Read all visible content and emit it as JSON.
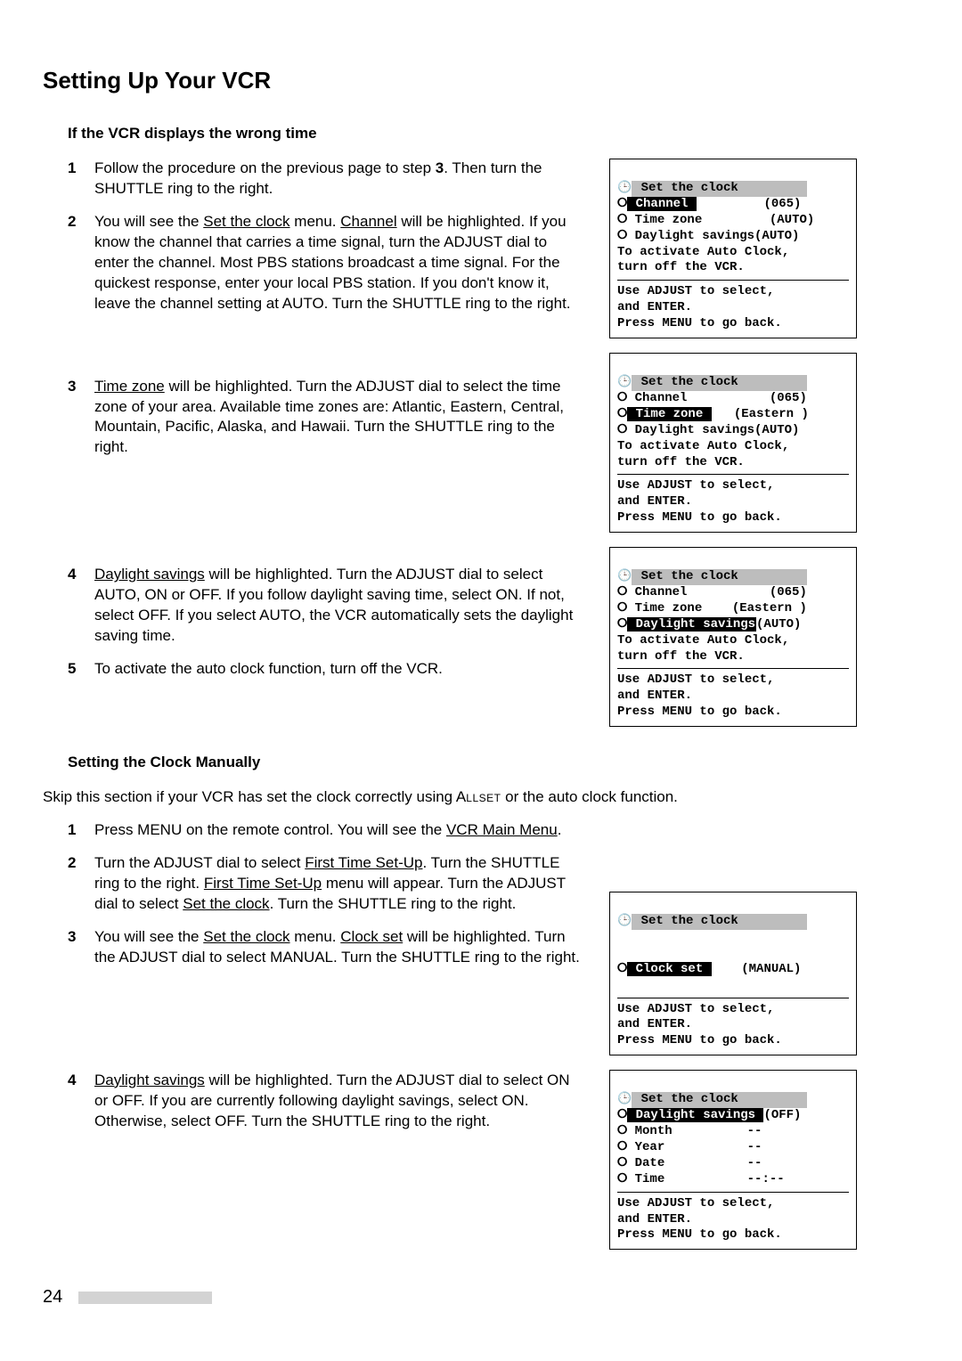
{
  "title": "Setting Up Your VCR",
  "sec1": {
    "heading": "If the VCR displays the wrong time",
    "s1a": "Follow the procedure on the previous page to step ",
    "s1b": "3",
    "s1c": ".  Then turn the SHUTTLE ring to the right.",
    "s2a": "You will see the ",
    "s2b": "Set the clock",
    "s2c": " menu.  ",
    "s2d": "Channel",
    "s2e": " will be highlighted.  If you know the channel that carries a time signal, turn the ADJUST dial to enter the channel.  Most PBS stations broadcast a time signal.  For the quickest response, enter your local PBS station.  If you don't know it, leave the channel setting at AUTO.  Turn the SHUTTLE ring to the right.",
    "s3a": "Time zone",
    "s3b": " will be highlighted.  Turn the ADJUST dial to select the time zone of your area.  Available time zones are:  Atlantic, Eastern, Central, Mountain, Pacific, Alaska, and Hawaii.  Turn the SHUTTLE ring to the right.",
    "s4a": "Daylight savings",
    "s4b": " will be highlighted.  Turn the ADJUST dial to select AUTO, ON or OFF.  If you follow daylight saving time, select ON.  If not, select OFF.  If you select AUTO, the VCR automatically sets the daylight saving time.",
    "s5": "To activate the auto clock function, turn off the VCR."
  },
  "sec2": {
    "heading": "Setting the Clock Manually",
    "introA": "Skip this section if your VCR has set the clock correctly using A",
    "introB": "llset",
    "introC": " or the auto clock function.",
    "s1": "Press MENU on the remote control.  You will see the ",
    "s1u": "VCR Main Menu",
    "s1end": ".",
    "s2a": "Turn the ADJUST dial to select ",
    "s2b": "First Time Set-Up",
    "s2c": ".  Turn the SHUTTLE ring to the right.  ",
    "s2d": "First Time Set-Up",
    "s2e": " menu will appear.  Turn the ADJUST dial to select ",
    "s2f": "Set the clock",
    "s2g": ".  Turn the SHUTTLE ring to the right.",
    "s3a": "You will see the ",
    "s3b": "Set the clock",
    "s3c": " menu.  ",
    "s3d": "Clock set",
    "s3e": " will be highlighted.  Turn the ADJUST dial to select MANUAL.  Turn the SHUTTLE ring to the right.",
    "s4a": "Daylight savings",
    "s4b": " will be highlighted.  Turn the ADJUST dial to select ON or OFF.  If you are currently following daylight savings, select ON.  Otherwise, select OFF.  Turn the SHUTTLE ring to the right."
  },
  "osd": {
    "title": "Set the clock",
    "channel": "Channel",
    "timezone": "Time zone",
    "daylight": "Daylight savings",
    "clockset": "Clock set",
    "month": "Month",
    "year": "Year",
    "date": "Date",
    "time": "Time",
    "v065": "(065)",
    "vAuto": "(AUTO)",
    "vEastern": "(Eastern )",
    "vManual": "(MANUAL)",
    "vOff": "(OFF)",
    "dashes": "--",
    "dashesTime": "--:--",
    "act1": "To activate Auto Clock,",
    "act2": "turn off the VCR.",
    "help1": "Use ADJUST to select,",
    "help2": "and ENTER.",
    "help3": "Press MENU to go back."
  },
  "pageNumber": "24"
}
